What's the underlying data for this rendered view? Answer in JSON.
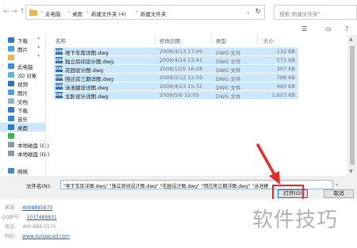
{
  "address_bar": {
    "crumbs": [
      "此电脑",
      "桌面",
      "新建文件夹 (4)",
      "新建文件夹"
    ],
    "separator": "›",
    "search_placeholder": "搜索\"新建文件夹\""
  },
  "sidebar": {
    "items": [
      {
        "label": "下载",
        "pinned": true
      },
      {
        "label": "图片",
        "pinned": true
      },
      {
        "label": "",
        "pinned": true
      },
      {
        "label": "此电脑",
        "pinned": false
      },
      {
        "label": "3D 对象",
        "pinned": false
      },
      {
        "label": "视频",
        "pinned": false
      },
      {
        "label": "图片",
        "pinned": false
      },
      {
        "label": "文档",
        "pinned": false
      },
      {
        "label": "下载",
        "pinned": false
      },
      {
        "label": "音乐",
        "pinned": false
      },
      {
        "label": "桌面",
        "pinned": false,
        "selected": true
      },
      {
        "label": "",
        "pinned": false
      },
      {
        "label": "本地磁盘 (C:)",
        "pinned": false
      },
      {
        "label": "本地磁盘 (D:)",
        "pinned": false
      },
      {
        "label": "",
        "pinned": false
      },
      {
        "label": "网络",
        "pinned": false
      }
    ]
  },
  "file_list": {
    "columns": [
      "名称",
      "修改日期",
      "类型",
      "大小"
    ],
    "rows": [
      {
        "name": "地下车库详图.dwg",
        "date": "2009/4/13 17:09",
        "type": "DWG 文件",
        "size": "132 KB"
      },
      {
        "name": "独立房间设计图.dwg",
        "date": "2009/4/14 13:41",
        "type": "DWG 文件",
        "size": "571 KB"
      },
      {
        "name": "花园设计图.dwg",
        "date": "2008/12/5 16:28",
        "type": "DWG 文件",
        "size": "307 KB"
      },
      {
        "name": "回迁房三期详图.dwg",
        "date": "2009/3/12 13:59",
        "type": "DWG 文件",
        "size": "788 KB"
      },
      {
        "name": "泳池建设详图.dwg",
        "date": "2009/4/23 15:32",
        "type": "DWG 文件",
        "size": "480 KB"
      },
      {
        "name": "主卧设计详图.dwg",
        "date": "2009/5/6 12:05",
        "type": "DWG 文件",
        "size": "1,623 KB"
      }
    ],
    "file_icon_text": "DWG"
  },
  "bottom_bar": {
    "filename_label": "文件名(N):",
    "filename_value": "\"地下车库详图.dwg\" \"独立房间设计图.dwg\" \"花园设计图.dwg\" \"回迁房三期详图.dwg\" \"泳池建",
    "open_label": "打开(O)",
    "cancel_label": "取消"
  },
  "lower_info": {
    "rows": [
      {
        "label": "客服:",
        "value": "4008885870",
        "link": true
      },
      {
        "label": "QQ群号:",
        "value": "1037489831",
        "link": true
      },
      {
        "label": "电话:",
        "value": "400-888-5570",
        "link": false
      },
      {
        "label": "网址:",
        "value": "www.xunjiecad.com",
        "link": true
      }
    ]
  },
  "watermark": "软件技巧",
  "colors": {
    "selection": "#cce8ff",
    "highlight": "#e52b2b",
    "file_icon": "#2f6fbd",
    "link": "#1a5fb4"
  }
}
